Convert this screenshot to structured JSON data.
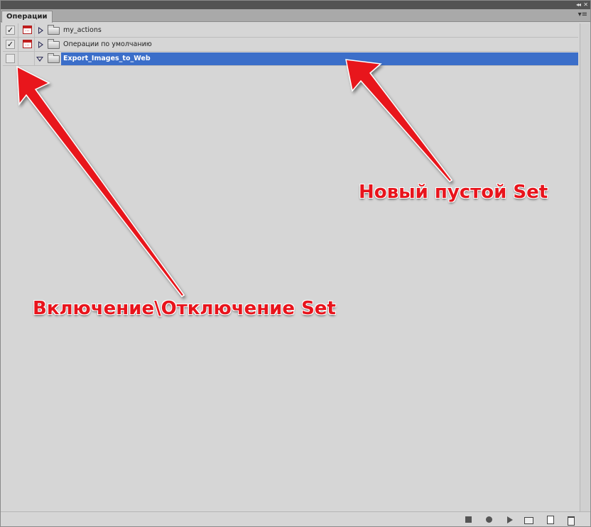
{
  "panel": {
    "tab_label": "Операции",
    "collapse_glyph": "◂◂",
    "close_glyph": "✕",
    "menu_glyph": "▾≡"
  },
  "action_sets": [
    {
      "label": "my_actions",
      "enabled": true,
      "check_glyph": "✓",
      "dialog_toggle": true,
      "expanded": false,
      "selected": false
    },
    {
      "label": "Операции по умолчанию",
      "enabled": true,
      "check_glyph": "✓",
      "dialog_toggle": true,
      "expanded": false,
      "selected": false
    },
    {
      "label": "Export_Images_to_Web",
      "enabled": false,
      "check_glyph": "",
      "dialog_toggle": false,
      "expanded": true,
      "selected": true
    }
  ],
  "toolbar": {
    "buttons": [
      "stop-icon",
      "record-icon",
      "play-icon",
      "new-set-icon",
      "new-action-icon",
      "trash-icon"
    ]
  },
  "annotations": {
    "new_set": "Новый пустой Set",
    "toggle_set": "Включение\\Отключение Set",
    "color": "#e8141c"
  },
  "colors": {
    "panel_bg": "#d6d6d6",
    "selection": "#3b6ec9",
    "titlebar": "#535353"
  }
}
